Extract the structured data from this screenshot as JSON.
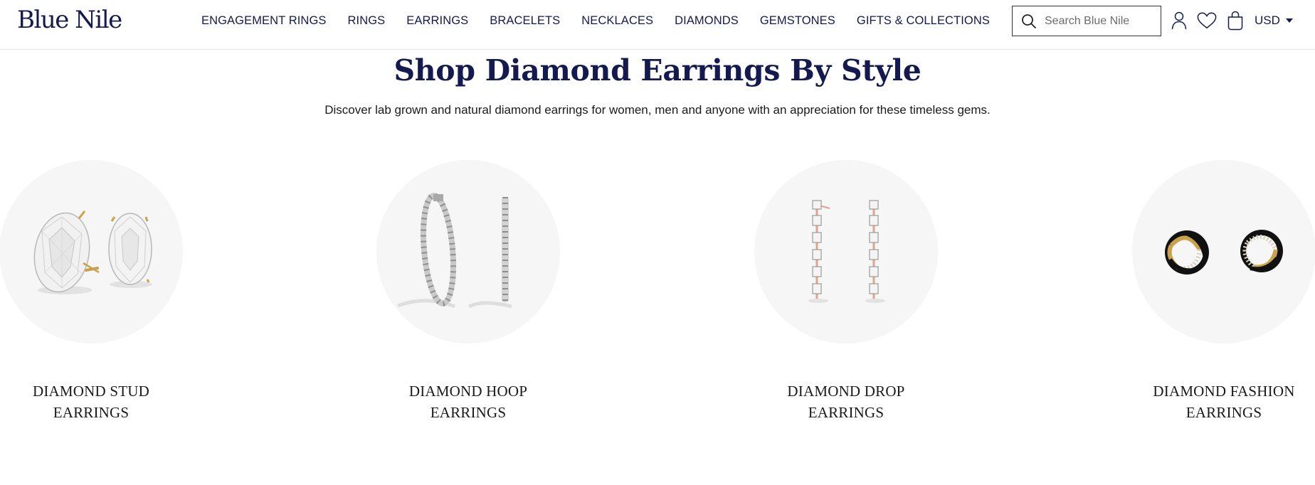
{
  "header": {
    "logo": "Blue Nile",
    "nav": [
      "ENGAGEMENT RINGS",
      "RINGS",
      "EARRINGS",
      "BRACELETS",
      "NECKLACES",
      "DIAMONDS",
      "GEMSTONES",
      "GIFTS & COLLECTIONS"
    ],
    "search": {
      "placeholder": "Search Blue Nile",
      "value": ""
    },
    "currency": "USD",
    "icons": [
      "search-icon",
      "account-icon",
      "heart-icon",
      "shopping-bag-icon",
      "chevron-down-icon"
    ]
  },
  "main": {
    "title": "Shop Diamond Earrings By Style",
    "subtitle": "Discover lab grown and natural diamond earrings for women, men and anyone with an appreciation for these timeless gems.",
    "categories": [
      {
        "line1": "DIAMOND STUD",
        "line2": "EARRINGS",
        "image": "oval-diamond-stud-earrings"
      },
      {
        "line1": "DIAMOND HOOP",
        "line2": "EARRINGS",
        "image": "diamond-hoop-earrings"
      },
      {
        "line1": "DIAMOND DROP",
        "line2": "EARRINGS",
        "image": "emerald-cut-diamond-drop-earrings"
      },
      {
        "line1": "DIAMOND FASHION",
        "line2": "EARRINGS",
        "image": "black-enamel-knot-diamond-earrings"
      }
    ]
  },
  "colors": {
    "brand_navy": "#141a4f",
    "circle_bg": "#f6f6f6",
    "gold": "#c9a24a",
    "rose_gold": "#e0a38b"
  }
}
